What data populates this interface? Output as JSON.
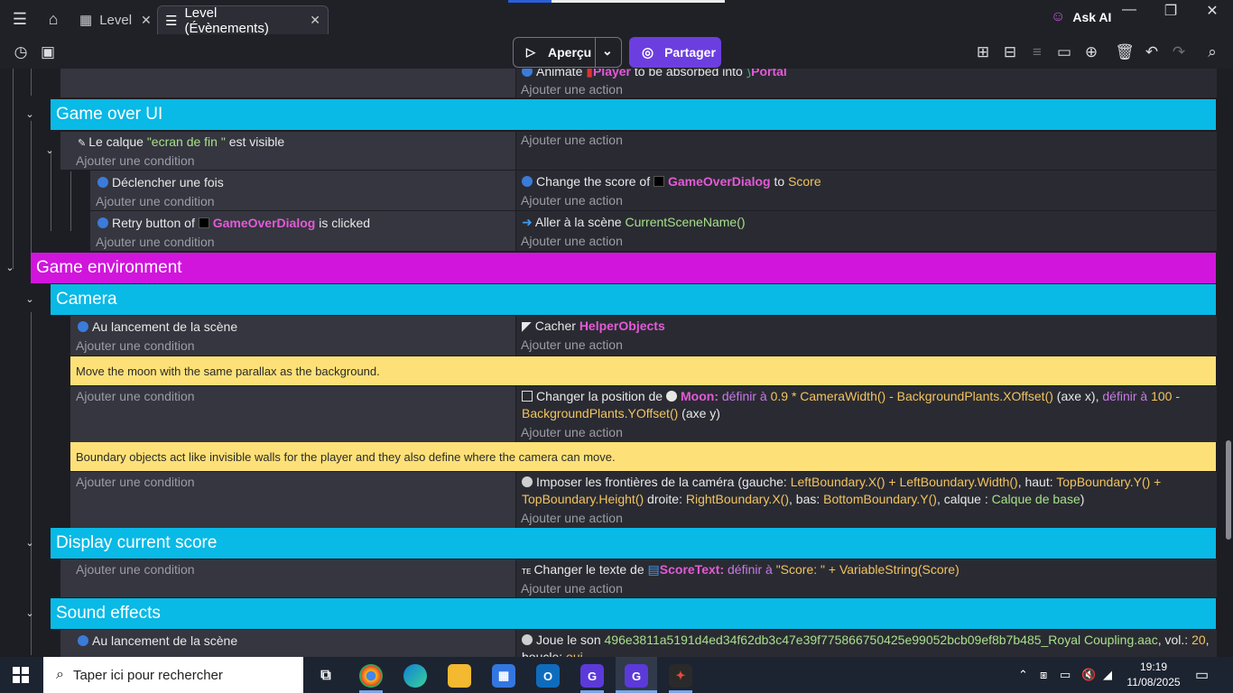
{
  "titlebar": {
    "tabs": [
      {
        "label": "Level",
        "close": "✕"
      },
      {
        "label": "Level (Évènements)",
        "close": "✕"
      }
    ],
    "ask_ai": "Ask AI",
    "window_controls": {
      "minimize": "—",
      "restore": "❐",
      "close": "✕"
    }
  },
  "toolbar": {
    "preview": "Aperçu",
    "share": "Partager",
    "icons": [
      "add-event-icon",
      "add-subevent-icon",
      "add-group-icon",
      "add-comment-icon",
      "add-other-icon",
      "delete-icon",
      "undo-icon",
      "redo-icon",
      "search-icon"
    ]
  },
  "sheet": {
    "top": {
      "action_partial": "Animate",
      "action_obj1": "Player",
      "action_mid": "to be absorbed into",
      "action_obj2": "Portal",
      "add_action": "Ajouter une action"
    },
    "game_over_ui": {
      "title": "Game over UI",
      "cond1_prefix": "Le calque",
      "cond1_str": "\"ecran de fin \"",
      "cond1_suffix": "est visible",
      "add_condition": "Ajouter une condition",
      "add_action": "Ajouter une action",
      "sub1_cond": "Déclencher une fois",
      "sub1_act_prefix": "Change the score of",
      "sub1_act_obj": "GameOverDialog",
      "sub1_act_to": "to",
      "sub1_act_val": "Score",
      "sub2_cond_prefix": "Retry button of",
      "sub2_cond_obj": "GameOverDialog",
      "sub2_cond_suffix": "is clicked",
      "sub2_act_prefix": "Aller à la scène",
      "sub2_act_val": "CurrentSceneName()"
    },
    "game_environment": {
      "title": "Game environment"
    },
    "camera": {
      "title": "Camera",
      "cond1": "Au lancement de la scène",
      "act1_prefix": "Cacher",
      "act1_obj": "HelperObjects",
      "comment1": "Move the moon with the same parallax as the background.",
      "act2_prefix": "Changer la position de",
      "act2_obj": "Moon",
      "act2_kw1": "définir à",
      "act2_val1": "0.9 * CameraWidth() - BackgroundPlants.XOffset()",
      "act2_axis1": "(axe x),",
      "act2_kw2": "définir à",
      "act2_val2a": "100 -",
      "act2_val2b": "BackgroundPlants.YOffset()",
      "act2_axis2": "(axe y)",
      "comment2": "Boundary objects act like invisible walls for the player and they also define where the camera can move.",
      "act3_l1_prefix": "Imposer les frontières de la caméra (gauche:",
      "act3_l1_v1": "LeftBoundary.X() + LeftBoundary.Width()",
      "act3_l1_mid": ", haut:",
      "act3_l1_v2": "TopBoundary.Y() +",
      "act3_l2_v1": "TopBoundary.Height()",
      "act3_l2_t1": "droite:",
      "act3_l2_v2": "RightBoundary.X()",
      "act3_l2_t2": ", bas:",
      "act3_l2_v3": "BottomBoundary.Y()",
      "act3_l2_t3": ", calque :",
      "act3_l2_v4": "Calque de base",
      "act3_l2_end": ")"
    },
    "display_score": {
      "title": "Display current score",
      "act_prefix": "Changer le texte de",
      "act_obj": "ScoreText",
      "act_kw": "définir à",
      "act_val": "\"Score: \" + VariableString(Score)"
    },
    "sound_effects": {
      "title": "Sound effects",
      "cond": "Au lancement de la scène",
      "act_prefix": "Joue le son",
      "act_val": "496e3811a5191d4ed34f62db3c47e39f775866750425e99052bcb09ef8b7b485_Royal Coupling.aac",
      "act_vol": ", vol.:",
      "act_vol_val": "20",
      "act_loop_partial": "boucle:",
      "act_loop_val": "oui"
    }
  },
  "taskbar": {
    "search_placeholder": "Taper ici pour rechercher",
    "time": "19:19",
    "date": "11/08/2025"
  },
  "colors": {
    "group_cyan": "#09b9e6",
    "group_magenta": "#d115dc",
    "comment_yellow": "#fde178",
    "object_pink": "#e25ad6",
    "string_green": "#a6e08a",
    "expression_orange": "#f2c35f",
    "accent_purple": "#6c3ee0"
  }
}
